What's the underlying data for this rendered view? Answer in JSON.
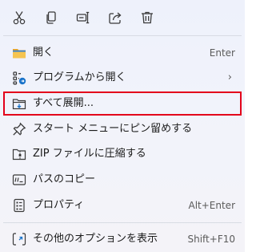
{
  "toolbar": {
    "buttons": [
      {
        "icon": "cut-icon"
      },
      {
        "icon": "copy-icon"
      },
      {
        "icon": "rename-icon"
      },
      {
        "icon": "share-icon"
      },
      {
        "icon": "delete-icon"
      }
    ]
  },
  "menu": {
    "items": [
      {
        "label": "開く",
        "accelerator": "Enter",
        "icon": "folder-open-icon"
      },
      {
        "label": "プログラムから開く",
        "submenu_arrow": "›",
        "icon": "open-with-icon"
      },
      {
        "label": "すべて展開...",
        "icon": "extract-all-icon",
        "highlighted": true
      },
      {
        "label": "スタート メニューにピン留めする",
        "icon": "pin-icon"
      },
      {
        "label": "ZIP ファイルに圧縮する",
        "icon": "zip-icon"
      },
      {
        "label": "パスのコピー",
        "icon": "copy-path-icon"
      },
      {
        "label": "プロパティ",
        "accelerator": "Alt+Enter",
        "icon": "properties-icon"
      },
      {
        "label": "その他のオプションを表示",
        "accelerator": "Shift+F10",
        "icon": "more-options-icon"
      }
    ]
  },
  "colors": {
    "highlight_border": "#e3001b",
    "accent": "#1a73c9",
    "folder": "#f2b73a"
  }
}
